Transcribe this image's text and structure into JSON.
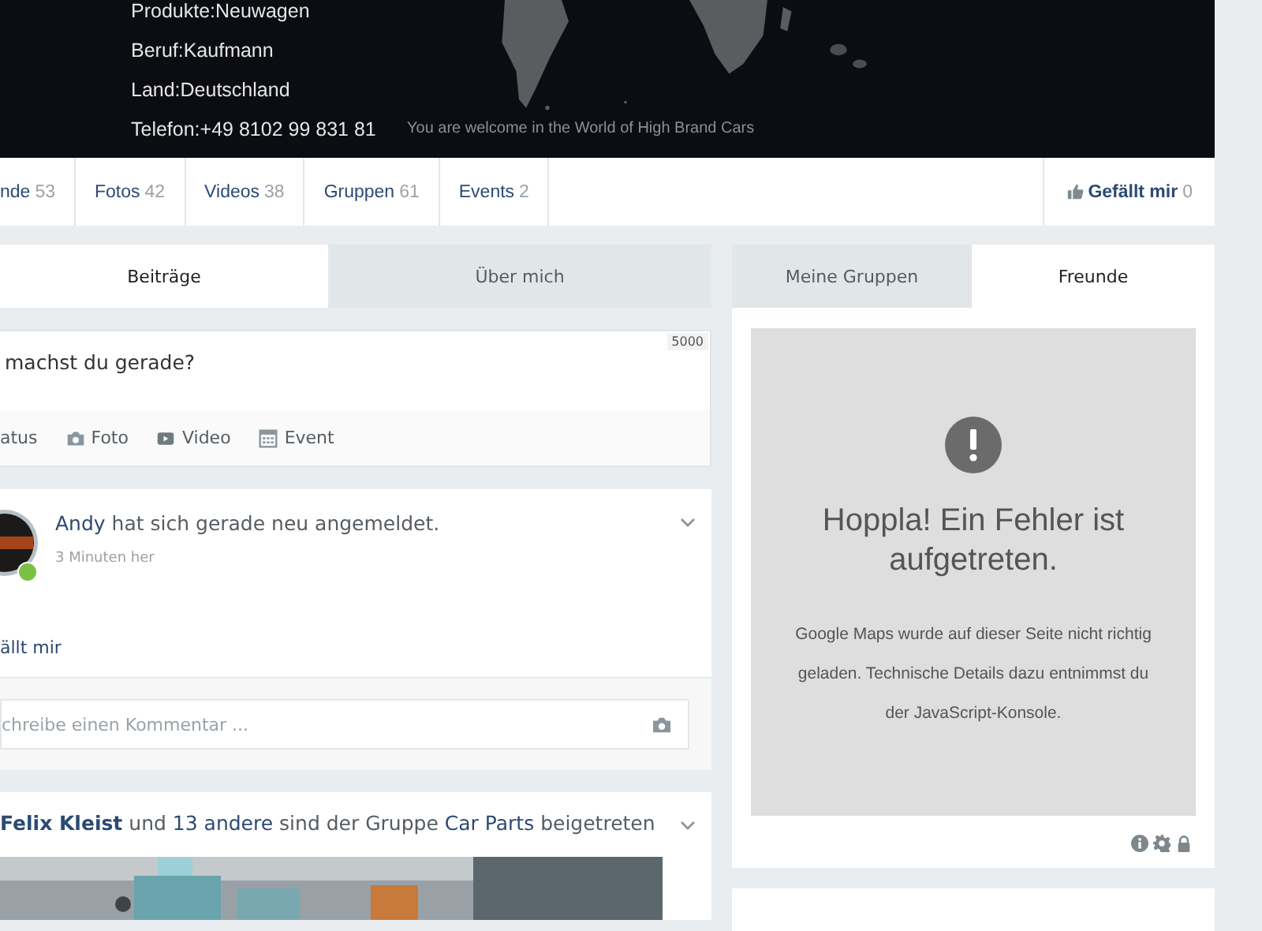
{
  "profile": {
    "details": [
      "Produkte:Neuwagen",
      "Beruf:Kaufmann",
      "Land:Deutschland",
      "Telefon:+49 8102 99 831 81"
    ],
    "caption": "You are welcome in the World of High Brand Cars"
  },
  "nav": [
    {
      "label": "nde",
      "count": "53"
    },
    {
      "label": "Fotos",
      "count": "42"
    },
    {
      "label": "Videos",
      "count": "38"
    },
    {
      "label": "Gruppen",
      "count": "61"
    },
    {
      "label": "Events",
      "count": "2"
    }
  ],
  "like": {
    "label": "Gefällt mir",
    "count": "0"
  },
  "main_tabs": [
    {
      "label": "Beiträge",
      "selected": true
    },
    {
      "label": "Über mich",
      "selected": false
    }
  ],
  "composer": {
    "placeholder": "machst du gerade?",
    "counter": "5000",
    "actions": [
      {
        "kind": "status",
        "label": "atus"
      },
      {
        "label": "Foto"
      },
      {
        "kind": "video",
        "label": "Video"
      },
      {
        "kind": "event",
        "label": "Event"
      }
    ]
  },
  "feed": [
    {
      "online": true,
      "segments": [
        {
          "kind": "link",
          "text": "Andy"
        },
        {
          "kind": "text",
          "text": "hat sich gerade neu angemeldet."
        }
      ],
      "time": "3 Minuten her",
      "like_link": "ällt mir",
      "comment_placeholder": "chreibe einen Kommentar ..."
    },
    {
      "segments": [
        {
          "kind": "strong",
          "text": "Felix Kleist"
        },
        {
          "kind": "text",
          "text": "und"
        },
        {
          "kind": "link",
          "text": "13 andere"
        },
        {
          "kind": "text",
          "text": "sind der Gruppe"
        },
        {
          "kind": "link",
          "text": "Car Parts"
        },
        {
          "kind": "text",
          "text": "beigetreten"
        }
      ]
    }
  ],
  "side_tabs": [
    {
      "label": "Meine Gruppen",
      "selected": false
    },
    {
      "label": "Freunde",
      "selected": true
    }
  ],
  "map_error": {
    "title": "Hoppla! Ein Fehler ist aufgetreten.",
    "message": "Google Maps wurde auf dieser Seite nicht richtig geladen. Technische Details dazu entnimmst du der JavaScript-Konsole."
  }
}
